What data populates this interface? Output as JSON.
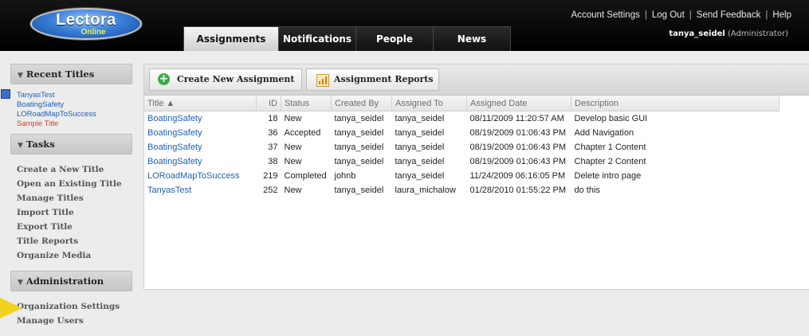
{
  "brand": {
    "name": "Lectora",
    "sub": "Online"
  },
  "top_links": [
    "Account Settings",
    "Log Out",
    "Send Feedback",
    "Help"
  ],
  "user": {
    "name": "tanya_seidel",
    "role": "(Administrator)"
  },
  "nav_tabs": [
    {
      "label": "Assignments",
      "active": true
    },
    {
      "label": "Notifications",
      "active": false
    },
    {
      "label": "People",
      "active": false
    },
    {
      "label": "News",
      "active": false
    }
  ],
  "sidebar": {
    "recent": {
      "heading": "Recent Titles",
      "items": [
        {
          "label": "TanyasTest"
        },
        {
          "label": "BoatingSafety"
        },
        {
          "label": "LORoadMapToSuccess"
        },
        {
          "label": "Sample Title"
        }
      ]
    },
    "tasks": {
      "heading": "Tasks",
      "items": [
        "Create a New Title",
        "Open an Existing Title",
        "Manage Titles",
        "Import Title",
        "Export Title",
        "Title Reports",
        "Organize Media"
      ]
    },
    "admin": {
      "heading": "Administration",
      "items": [
        "Organization Settings",
        "Manage Users"
      ]
    }
  },
  "toolbar": {
    "create_label": "Create New Assignment",
    "reports_label": "Assignment Reports"
  },
  "table": {
    "columns": [
      "Title ▲",
      "ID",
      "Status",
      "Created By",
      "Assigned To",
      "Assigned Date",
      "Description"
    ],
    "rows": [
      [
        "BoatingSafety",
        "18",
        "New",
        "tanya_seidel",
        "tanya_seidel",
        "08/11/2009 11:20:57 AM",
        "Develop basic GUI"
      ],
      [
        "BoatingSafety",
        "36",
        "Accepted",
        "tanya_seidel",
        "tanya_seidel",
        "08/19/2009 01:06:43 PM",
        "Add Navigation"
      ],
      [
        "BoatingSafety",
        "37",
        "New",
        "tanya_seidel",
        "tanya_seidel",
        "08/19/2009 01:06:43 PM",
        "Chapter 1 Content"
      ],
      [
        "BoatingSafety",
        "38",
        "New",
        "tanya_seidel",
        "tanya_seidel",
        "08/19/2009 01:06:43 PM",
        "Chapter 2 Content"
      ],
      [
        "LORoadMapToSuccess",
        "219",
        "Completed",
        "johnb",
        "tanya_seidel",
        "11/24/2009 06:16:05 PM",
        "Delete intro page"
      ],
      [
        "TanyasTest",
        "252",
        "New",
        "tanya_seidel",
        "laura_michalow",
        "01/28/2010 01:55:22 PM",
        "do this"
      ]
    ]
  }
}
